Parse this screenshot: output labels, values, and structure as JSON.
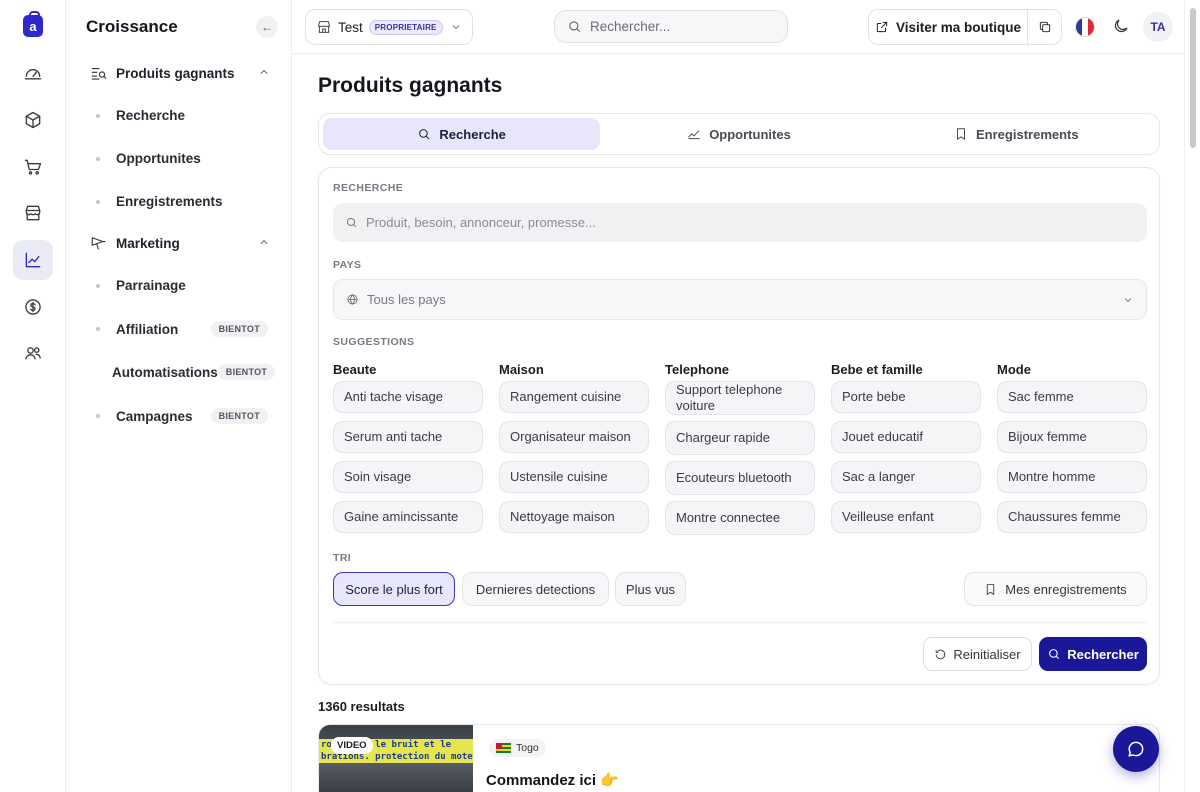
{
  "sidebar": {
    "title": "Croissance",
    "groups": [
      {
        "label": "Produits gagnants",
        "items": [
          "Recherche",
          "Opportunites",
          "Enregistrements"
        ]
      },
      {
        "label": "Marketing",
        "items": [
          "Parrainage",
          "Affiliation",
          "Automatisations",
          "Campagnes"
        ]
      }
    ],
    "soon_badge": "BIENTOT"
  },
  "topbar": {
    "store_name": "Test",
    "role_badge": "PROPRIETAIRE",
    "search_placeholder": "Rechercher...",
    "visit_label": "Visiter ma boutique",
    "avatar_initials": "TA"
  },
  "page": {
    "title": "Produits gagnants",
    "tabs": [
      "Recherche",
      "Opportunites",
      "Enregistrements"
    ]
  },
  "search_panel": {
    "search_label": "RECHERCHE",
    "search_placeholder": "Produit, besoin, annonceur, promesse...",
    "country_label": "PAYS",
    "country_value": "Tous les pays",
    "suggestions_label": "SUGGESTIONS",
    "suggestions": [
      {
        "title": "Beaute",
        "items": [
          "Anti tache visage",
          "Serum anti tache",
          "Soin visage",
          "Gaine amincissante"
        ]
      },
      {
        "title": "Maison",
        "items": [
          "Rangement cuisine",
          "Organisateur maison",
          "Ustensile cuisine",
          "Nettoyage maison"
        ]
      },
      {
        "title": "Telephone",
        "items": [
          "Support telephone voiture",
          "Chargeur rapide",
          "Ecouteurs bluetooth",
          "Montre connectee"
        ]
      },
      {
        "title": "Bebe et famille",
        "items": [
          "Porte bebe",
          "Jouet educatif",
          "Sac a langer",
          "Veilleuse enfant"
        ]
      },
      {
        "title": "Mode",
        "items": [
          "Sac femme",
          "Bijoux femme",
          "Montre homme",
          "Chaussures femme"
        ]
      }
    ],
    "sort_label": "TRI",
    "sort_options": [
      "Score le plus fort",
      "Dernieres detections",
      "Plus vus"
    ],
    "saved_label": "Mes enregistrements",
    "reset_label": "Reinitialiser",
    "search_button": "Rechercher"
  },
  "results": {
    "count_text": "1360 resultats",
    "first": {
      "badge": "VIDEO",
      "thumb_caption_1": "ro contre le bruit et le",
      "thumb_caption_2": "brations. protection du moteu",
      "country": "Togo",
      "title": "Commandez ici 👉"
    }
  },
  "colors": {
    "accent": "#1b1799",
    "accent_soft": "#e7e6fb"
  }
}
